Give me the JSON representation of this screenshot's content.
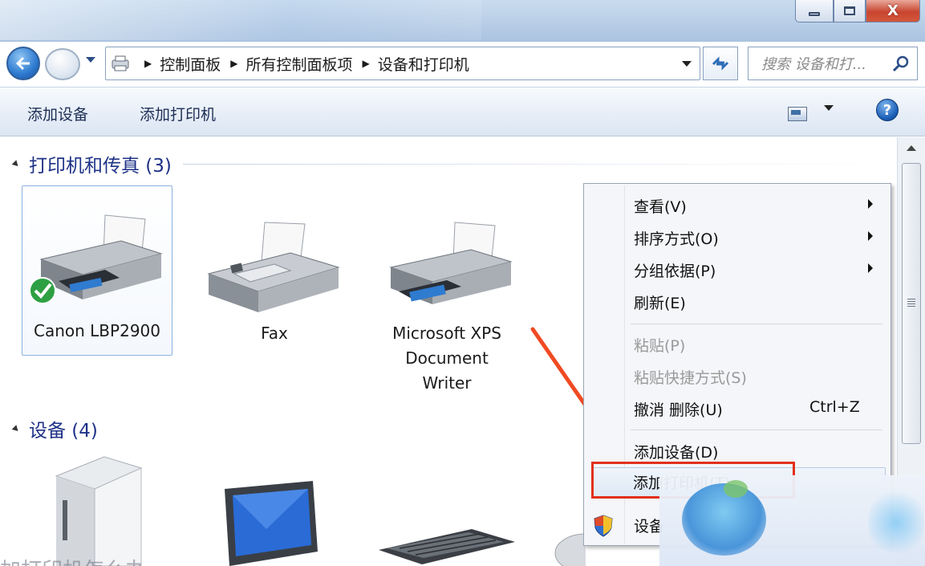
{
  "window": {
    "controls": [
      "minimize",
      "maximize",
      "close"
    ],
    "close_glyph": "X"
  },
  "address": {
    "crumbs": [
      "控制面板",
      "所有控制面板项",
      "设备和打印机"
    ]
  },
  "search": {
    "placeholder": "搜索 设备和打..."
  },
  "toolbar": {
    "add_device": "添加设备",
    "add_printer": "添加打印机",
    "help_glyph": "?"
  },
  "groups": {
    "printers": {
      "title": "打印机和传真 (3)",
      "items": [
        {
          "name": "Canon LBP2900",
          "default": true
        },
        {
          "name": "Fax"
        },
        {
          "name_lines": [
            "Microsoft XPS",
            "Document",
            "Writer"
          ]
        }
      ]
    },
    "devices": {
      "title": "设备 (4)"
    }
  },
  "context_menu": {
    "items": [
      {
        "label": "查看(V)",
        "submenu": true
      },
      {
        "label": "排序方式(O)",
        "submenu": true
      },
      {
        "label": "分组依据(P)",
        "submenu": true
      },
      {
        "label": "刷新(E)"
      },
      {
        "label": "粘贴(P)",
        "disabled": true
      },
      {
        "label": "粘贴快捷方式(S)",
        "disabled": true
      },
      {
        "label": "撤消 删除(U)",
        "shortcut": "Ctrl+Z"
      },
      {
        "label": "添加设备(D)"
      },
      {
        "label": "添加打印机(T)",
        "highlighted": true
      },
      {
        "label": "设备"
      }
    ]
  },
  "colors": {
    "accent_blue": "#1e3287",
    "highlight_red": "#e2301c",
    "default_check": "#2ea043"
  },
  "caption": "加打印机怎么办"
}
